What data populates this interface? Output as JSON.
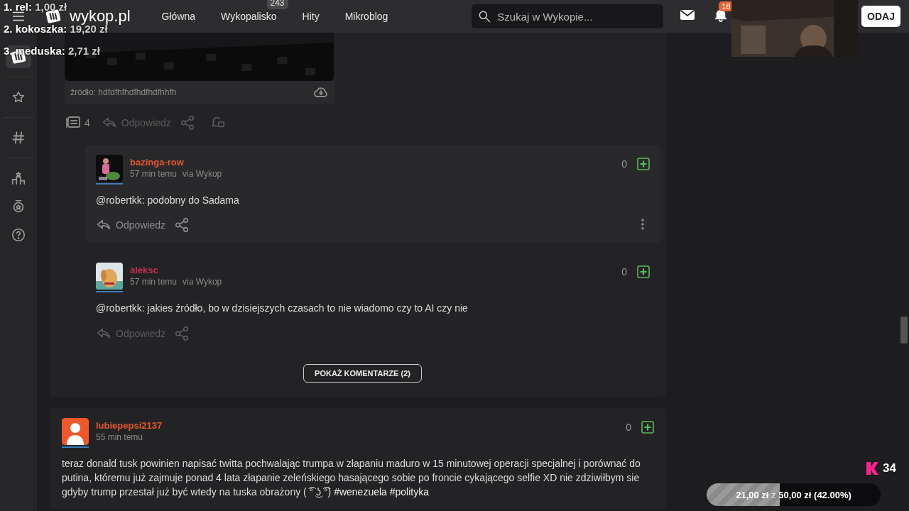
{
  "overlay": {
    "leaderboard": [
      {
        "rank": "1.",
        "name": "rel:",
        "amount": "1,00 zł"
      },
      {
        "rank": "2.",
        "name": "kokoszka:",
        "amount": "19,20 zł"
      },
      {
        "rank": "3.",
        "name": "meduska:",
        "amount": "2,71 zł"
      }
    ],
    "counter": {
      "value": "34"
    },
    "goal": {
      "raised": "21,00 zł",
      "sep": "z",
      "target": "50,00 zł (42.00%)",
      "level": 0.42
    }
  },
  "topbar": {
    "logo": "wykop.pl",
    "nav": [
      {
        "label": "Główna"
      },
      {
        "label": "Wykopalisko",
        "badge": "243"
      },
      {
        "label": "Hity"
      },
      {
        "label": "Mikroblog"
      }
    ],
    "search": {
      "placeholder": "Szukaj w Wykopie..."
    },
    "notifications": "18",
    "add_button": "ODAJ"
  },
  "sidebar": {
    "items": [
      {
        "kind": "logo",
        "selected": true
      },
      {
        "kind": "star",
        "selected": false
      },
      {
        "kind": "hash",
        "selected": false
      },
      {
        "kind": "ranking",
        "selected": false
      },
      {
        "kind": "badge",
        "selected": false
      },
      {
        "kind": "help",
        "selected": false
      }
    ]
  },
  "post": {
    "source": "źródło: hdfdfhfhdfhdfhdfhhfh",
    "comments_count": "4",
    "reply": "Odpowiedz"
  },
  "comments": [
    {
      "author": "bazinga-row",
      "color": "#e4582f",
      "time": "57 min temu",
      "via": "via Wykop",
      "text": "@robertkk: podobny do Sadama",
      "votes": "0",
      "reply": "Odpowiedz",
      "highlighted": true
    },
    {
      "author": "aleksc",
      "color": "#c5304d",
      "time": "57 min temu",
      "via": "via Wykop",
      "text": "@robertkk: jakies źródło, bo w dzisiejszych czasach to nie wiadomo czy to AI czy nie",
      "votes": "0",
      "reply": "Odpowiedz",
      "highlighted": false
    }
  ],
  "show_more": "POKAŻ KOMENTARZE (2)",
  "next_post": {
    "author": "lubiepepsi2137",
    "color": "#e4582f",
    "time": "55 min temu",
    "votes": "0",
    "text": "teraz donald tusk powinien napisać twitta pochwalając trumpa w złapaniu maduro w 15 minutowej operacji specjalnej i porównać do putina, któremu już zajmuje ponad 4 lata złapanie zeleńskiego hasającego sobie po froncie cykającego selfie XD nie zdziwiłbym sie gdyby trump przestał już być wtedy na tuska obrażony ( ͡° ͜ʖ ͡°)",
    "tags": [
      "#wenezuela",
      "#polityka"
    ]
  }
}
